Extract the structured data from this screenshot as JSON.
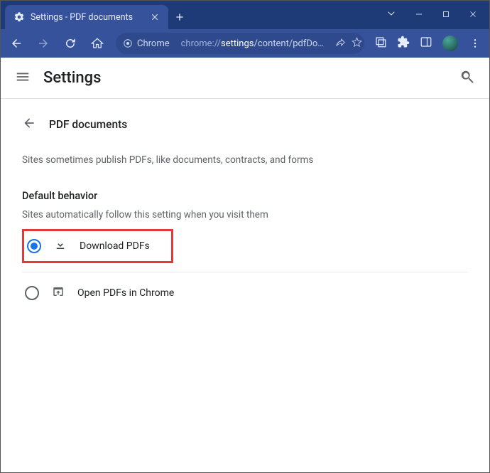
{
  "window": {
    "tab_title": "Settings - PDF documents"
  },
  "omnibox": {
    "scheme_label": "Chrome",
    "url_prefix": "chrome://",
    "url_bold": "settings",
    "url_suffix": "/content/pdfDo…"
  },
  "header": {
    "title": "Settings"
  },
  "page": {
    "title": "PDF documents",
    "description": "Sites sometimes publish PDFs, like documents, contracts, and forms",
    "section_title": "Default behavior",
    "section_subtitle": "Sites automatically follow this setting when you visit them",
    "options": [
      {
        "label": "Download PDFs",
        "selected": true
      },
      {
        "label": "Open PDFs in Chrome",
        "selected": false
      }
    ]
  }
}
